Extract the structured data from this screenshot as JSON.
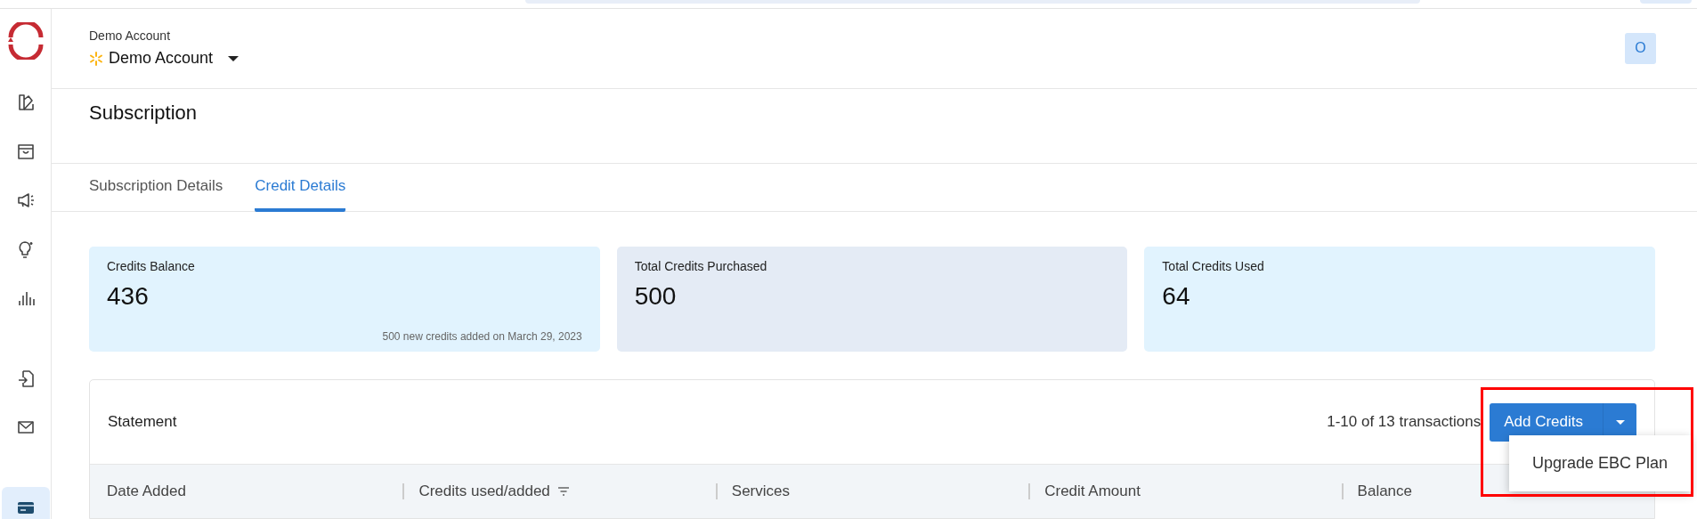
{
  "sidebar": {
    "items": [
      {
        "kind": "palette",
        "selected": false
      },
      {
        "kind": "store",
        "selected": false
      },
      {
        "kind": "megaphone",
        "selected": false
      },
      {
        "kind": "bulb",
        "selected": false
      },
      {
        "kind": "chart",
        "selected": false
      },
      {
        "kind": "file-import",
        "selected": false
      },
      {
        "kind": "mail",
        "selected": false
      },
      {
        "kind": "card",
        "selected": true
      }
    ]
  },
  "header": {
    "account_label": "Demo Account",
    "account_name": "Demo Account",
    "avatar": "O"
  },
  "page_title": "Subscription",
  "tabs": [
    {
      "label": "Subscription Details",
      "selected": false
    },
    {
      "label": "Credit Details",
      "selected": true
    }
  ],
  "cards": [
    {
      "title": "Credits Balance",
      "value": "436",
      "note": "500 new credits added on March 29, 2023",
      "color": "#e1f3fe"
    },
    {
      "title": "Total Credits Purchased",
      "value": "500",
      "color": "#e4ebf5"
    },
    {
      "title": "Total Credits Used",
      "value": "64",
      "color": "#e1f3fe"
    }
  ],
  "statement": {
    "title": "Statement",
    "count": "1-10 of 13 transactions",
    "add_button": "Add Credits",
    "menu": [
      "Upgrade EBC Plan"
    ],
    "columns": [
      {
        "label": "Date Added",
        "filter": false
      },
      {
        "label": "Credits used/added",
        "filter": true
      },
      {
        "label": "Services",
        "filter": false
      },
      {
        "label": "Credit Amount",
        "filter": false
      },
      {
        "label": "Balance",
        "filter": false
      }
    ]
  }
}
